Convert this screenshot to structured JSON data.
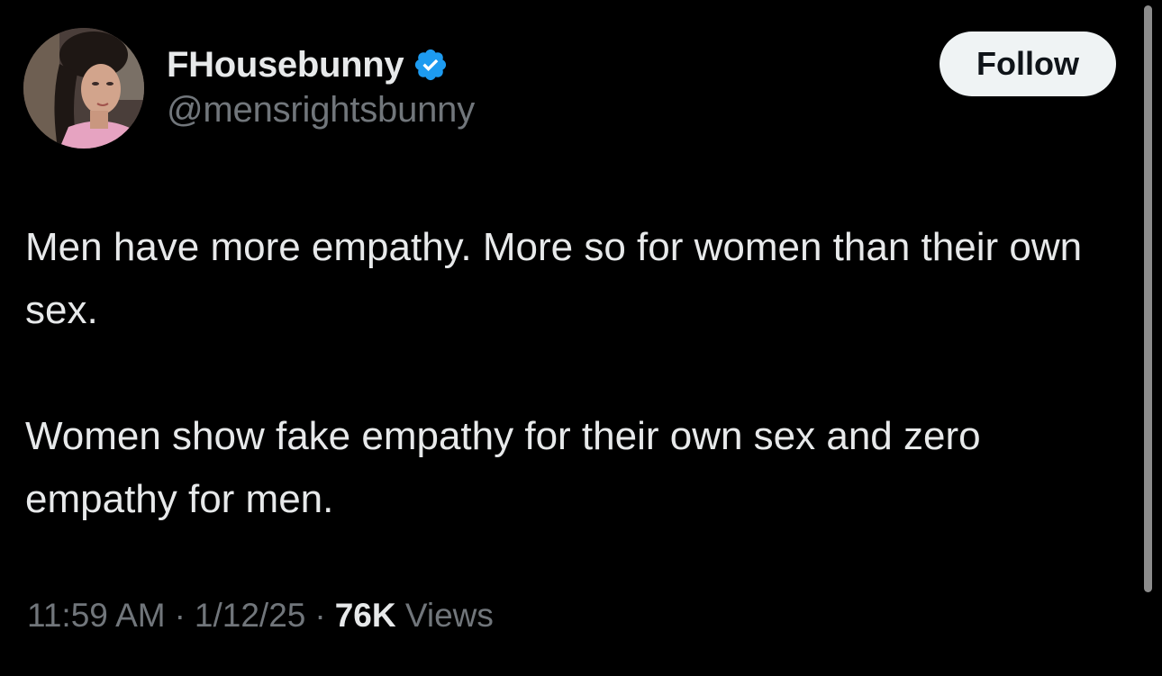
{
  "author": {
    "display_name": "FHousebunny",
    "handle": "@mensrightsbunny",
    "verified_icon": "verified-badge-icon",
    "avatar": "profile-photo"
  },
  "actions": {
    "follow_label": "Follow"
  },
  "tweet": {
    "paragraphs": [
      "Men have more empathy. More so for women than their own sex.",
      "Women show fake empathy for their own sex and zero empathy for men."
    ]
  },
  "meta": {
    "time": "11:59 AM",
    "separator": "·",
    "date": "1/12/25",
    "views_count": "76K",
    "views_label": "Views"
  },
  "colors": {
    "background": "#000000",
    "text_primary": "#e7e9ea",
    "text_secondary": "#71767b",
    "verified_blue": "#1d9bf0",
    "follow_bg": "#eff3f4"
  }
}
